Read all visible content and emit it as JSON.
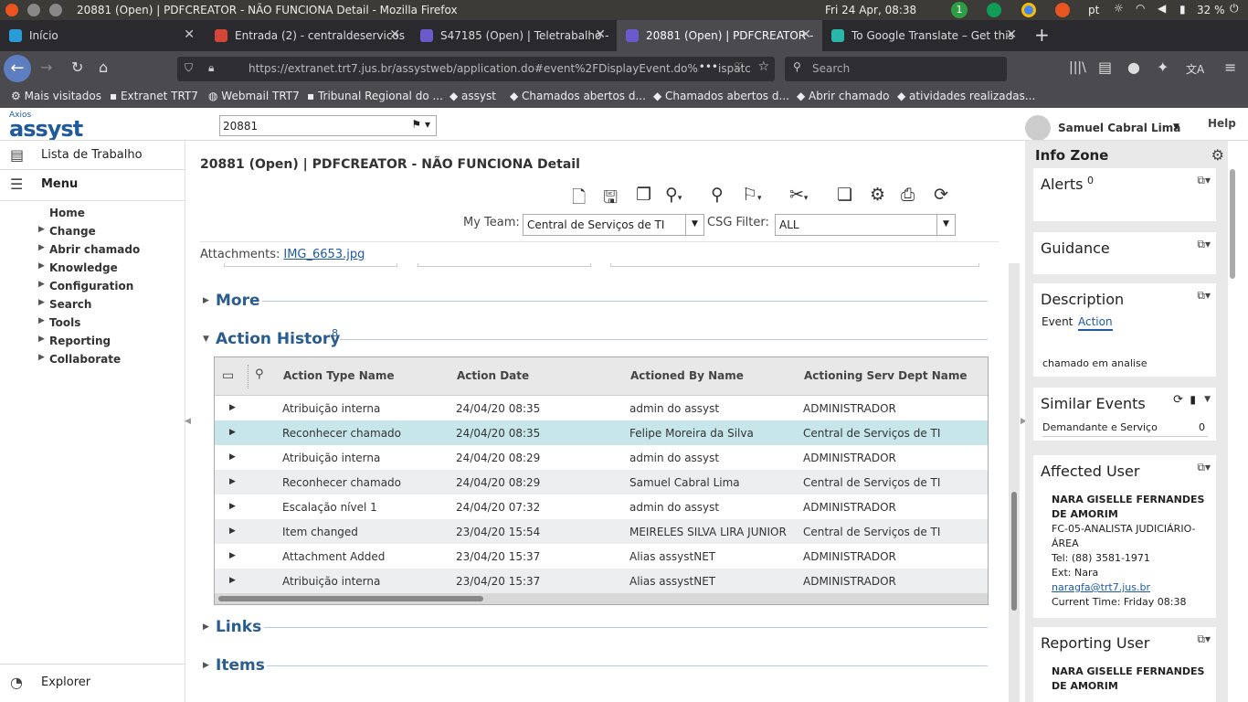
{
  "os": {
    "window_title": "20881 (Open) | PDFCREATOR - NÃO FUNCIONA Detail - Mozilla Firefox",
    "clock": "Fri 24 Apr, 08:38",
    "notif_count": "1",
    "lang": "pt",
    "battery": "32 %"
  },
  "browser": {
    "tabs": [
      {
        "label": "Início",
        "icon_color": "#2a9dd8"
      },
      {
        "label": "Entrada (2) - centraldeservicos",
        "icon_color": "#d44638"
      },
      {
        "label": "S47185 (Open) | Teletrabalho -",
        "icon_color": "#6a5acd"
      },
      {
        "label": "20881 (Open) | PDFCREATOR -",
        "icon_color": "#6a5acd"
      },
      {
        "label": "To Google Translate – Get this",
        "icon_color": "#2ab7a9"
      }
    ],
    "url": "https://extranet.trt7.jus.br/assystweb/application.do#event%2FDisplayEvent.do%3Fdispatc",
    "search_placeholder": "Search",
    "bookmarks": [
      "Mais visitados",
      "Extranet TRT7",
      "Webmail TRT7",
      "Tribunal Regional do ...",
      "assyst",
      "Chamados abertos d...",
      "Chamados abertos d...",
      "Abrir chamado",
      "atividades realizadas..."
    ]
  },
  "app": {
    "logo_small": "Axios",
    "logo": "assyst",
    "quick_search": "20881",
    "user_name": "Samuel Cabral Lima",
    "help": "Help",
    "sidebar": {
      "worklist": "Lista de Trabalho",
      "menu": "Menu",
      "explorer": "Explorer",
      "items": [
        "Home",
        "Change",
        "Abrir chamado",
        "Knowledge",
        "Configuration",
        "Search",
        "Tools",
        "Reporting",
        "Collaborate"
      ]
    },
    "page_title": "20881 (Open) | PDFCREATOR - NÃO FUNCIONA Detail",
    "my_team_label": "My Team:",
    "my_team_value": "Central de Serviços de TI",
    "csg_label": "CSG Filter:",
    "csg_value": "ALL",
    "attachments_label": "Attachments:",
    "attachment_file": "IMG_6653.jpg",
    "sections": {
      "more": "More",
      "action_history": "Action History",
      "action_count": "8",
      "links": "Links",
      "items": "Items"
    },
    "table": {
      "headers": [
        "Action Type Name",
        "Action Date",
        "Actioned By Name",
        "Actioning Serv Dept Name"
      ],
      "rows": [
        [
          "Atribuição interna",
          "24/04/20 08:35",
          "admin do assyst",
          "ADMINISTRADOR"
        ],
        [
          "Reconhecer chamado",
          "24/04/20 08:35",
          "Felipe Moreira da Silva",
          "Central de Serviços de TI"
        ],
        [
          "Atribuição interna",
          "24/04/20 08:29",
          "admin do assyst",
          "ADMINISTRADOR"
        ],
        [
          "Reconhecer chamado",
          "24/04/20 08:29",
          "Samuel Cabral Lima",
          "Central de Serviços de TI"
        ],
        [
          "Escalação nível 1",
          "24/04/20 07:32",
          "admin do assyst",
          "ADMINISTRADOR"
        ],
        [
          "Item changed",
          "23/04/20 15:54",
          "MEIRELES SILVA LIRA JUNIOR",
          "Central de Serviços de TI"
        ],
        [
          "Attachment Added",
          "23/04/20 15:37",
          "Alias assystNET",
          "ADMINISTRADOR"
        ],
        [
          "Atribuição interna",
          "23/04/20 15:37",
          "Alias assystNET",
          "ADMINISTRADOR"
        ]
      ]
    },
    "info_zone": {
      "title": "Info Zone",
      "alerts": "Alerts",
      "alerts_count": "0",
      "guidance": "Guidance",
      "description": "Description",
      "desc_tab_event": "Event",
      "desc_tab_action": "Action",
      "desc_text": "chamado em analise",
      "similar": "Similar Events",
      "similar_row": "Demandante e Serviço",
      "similar_count": "0",
      "affected": "Affected User",
      "affected_lines": [
        "NARA GISELLE FERNANDES",
        "DE AMORIM",
        "FC-05-ANALISTA JUDICIÁRIO-",
        "ÁREA",
        "Tel: (88) 3581-1971",
        "Ext: Nara",
        "naragfa@trt7.jus.br",
        "Current Time: Friday 08:38"
      ],
      "reporting": "Reporting User",
      "reporting_lines": [
        "NARA GISELLE FERNANDES",
        "DE AMORIM"
      ]
    }
  }
}
